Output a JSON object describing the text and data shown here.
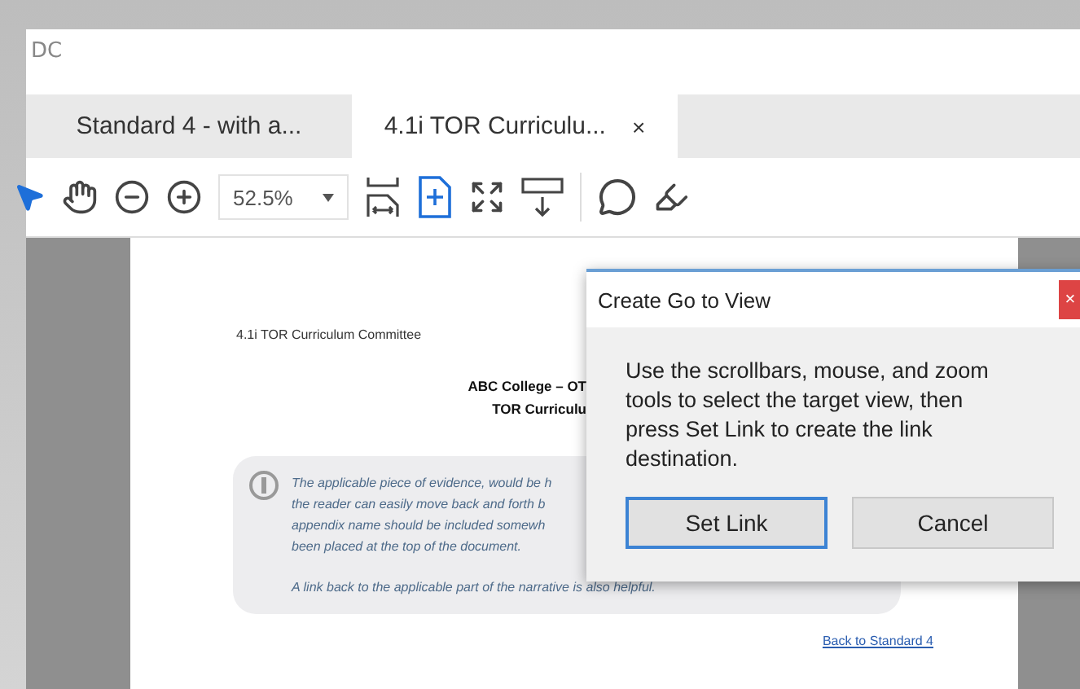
{
  "window": {
    "title": "DC"
  },
  "tabs": [
    {
      "label": "Standard 4 - with a...",
      "selected": false
    },
    {
      "label": "4.1i TOR Curriculu...",
      "selected": true,
      "close": "×"
    }
  ],
  "toolbar": {
    "zoom": "52.5%"
  },
  "document": {
    "header": "4.1i TOR Curriculum Committee",
    "title_lines": [
      "ABC College – OT",
      "TOR Curriculu"
    ],
    "note_lines": [
      "The applicable piece of evidence, would be h",
      "the reader can easily move back and forth b",
      "appendix name should be included somewh",
      "been placed at the top of the document."
    ],
    "note_footer": "A link back to the applicable part of the narrative is also helpful.",
    "link": "Back to Standard 4"
  },
  "dialog": {
    "title": "Create Go to View",
    "close": "×",
    "message": "Use the scrollbars, mouse, and zoom tools to select the target view, then press Set Link to create the link destination.",
    "buttons": [
      {
        "label": "Set Link",
        "selected": true
      },
      {
        "label": "Cancel",
        "selected": false
      }
    ]
  }
}
